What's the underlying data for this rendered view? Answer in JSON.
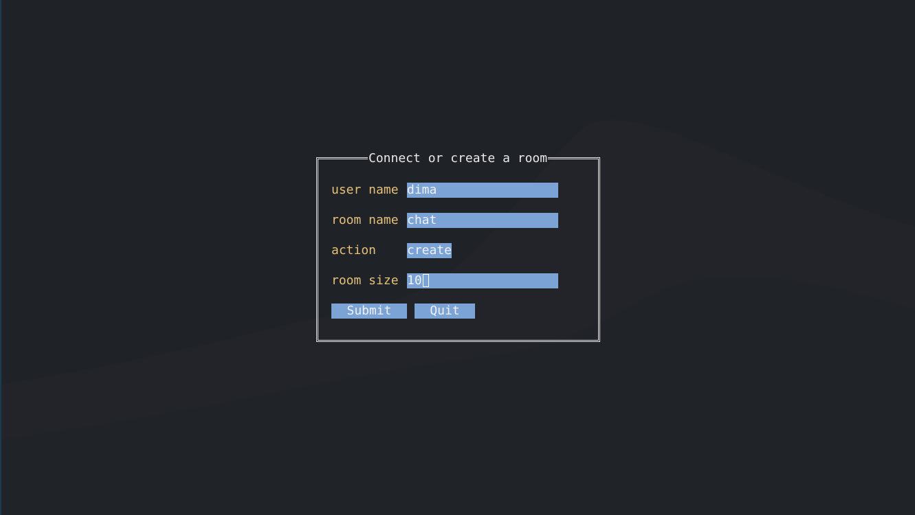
{
  "dialog": {
    "title": "Connect or create a room",
    "fields": {
      "user_name": {
        "label": "user name",
        "value": "dima"
      },
      "room_name": {
        "label": "room name",
        "value": "chat"
      },
      "action": {
        "label": "action",
        "value": "create"
      },
      "room_size": {
        "label": "room size",
        "value": "10"
      }
    },
    "buttons": {
      "submit": "Submit",
      "quit": "Quit"
    }
  },
  "colors": {
    "background": "#1f2226",
    "label": "#e5c07b",
    "field": "#7ba3d6",
    "border": "#e6e6e6"
  }
}
